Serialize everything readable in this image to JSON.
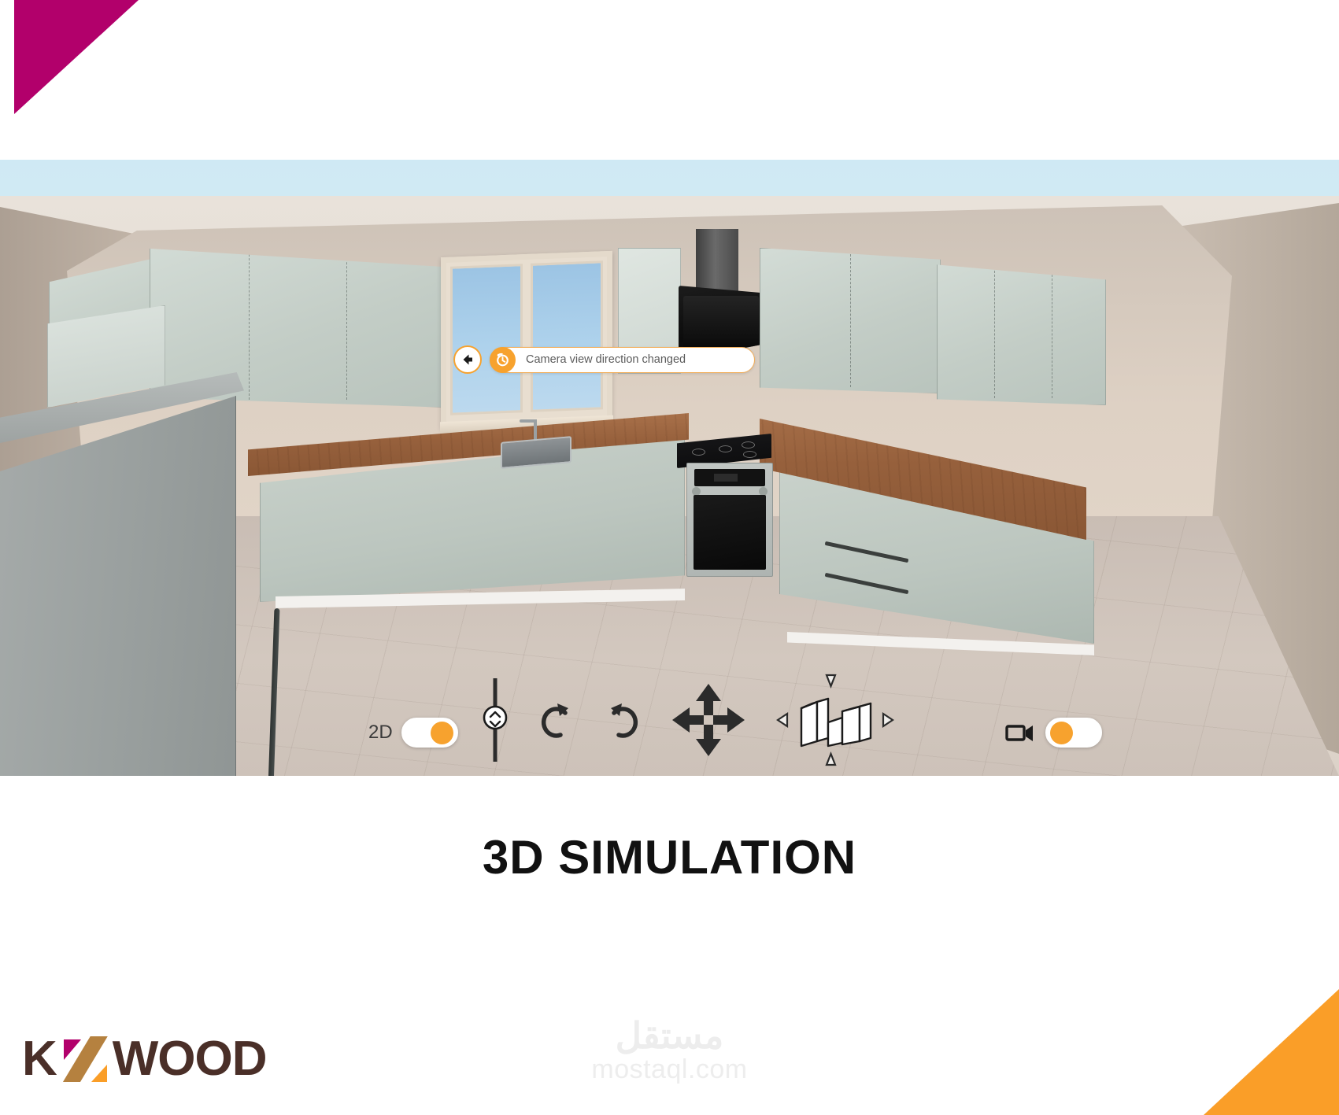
{
  "page": {
    "title": "3D SIMULATION",
    "accent_orange": "#f7a22e",
    "accent_magenta": "#b2006b",
    "brand_brown": "#4a2f28",
    "brand_tan": "#b5813f"
  },
  "notification": {
    "back_button_label": "Back",
    "back_icon": "arrow-left-icon",
    "history_icon": "undo-clock-icon",
    "message": "Camera view direction changed"
  },
  "viewport": {
    "name": "3d-kitchen-viewport",
    "scene": "Corner kitchen with sage-green cabinets, wood countertop, window, range hood, gas cooktop and built-in oven",
    "elements": [
      {
        "name": "upper-cabinet-left-corner",
        "type": "wall-cabinet"
      },
      {
        "name": "upper-cabinet-run-left",
        "type": "wall-cabinet"
      },
      {
        "name": "kitchen-window",
        "type": "window"
      },
      {
        "name": "upper-cabinet-narrow",
        "type": "wall-cabinet"
      },
      {
        "name": "range-hood",
        "type": "appliance"
      },
      {
        "name": "upper-cabinet-right-1",
        "type": "wall-cabinet"
      },
      {
        "name": "upper-cabinet-right-2",
        "type": "wall-cabinet"
      },
      {
        "name": "wood-countertop-left",
        "type": "countertop"
      },
      {
        "name": "wood-countertop-right",
        "type": "countertop"
      },
      {
        "name": "kitchen-sink",
        "type": "fixture"
      },
      {
        "name": "gas-cooktop",
        "type": "appliance"
      },
      {
        "name": "built-in-oven",
        "type": "appliance"
      },
      {
        "name": "base-cabinets-left",
        "type": "base-cabinet"
      },
      {
        "name": "base-cabinets-right",
        "type": "base-cabinet"
      },
      {
        "name": "tall-unit-refrigerator",
        "type": "tall-unit"
      },
      {
        "name": "tiled-floor",
        "type": "floor"
      }
    ]
  },
  "toolbar": {
    "mode_toggle": {
      "label": "2D",
      "state": "on",
      "knob_side": "right"
    },
    "camera_toggle": {
      "icon": "video-camera-icon",
      "state": "on",
      "knob_side": "left"
    },
    "tools": [
      {
        "name": "height-slider",
        "icon": "vertical-slider-icon",
        "label": "Height"
      },
      {
        "name": "rotate-left-tool",
        "icon": "rotate-ccw-icon",
        "label": "Rotate"
      },
      {
        "name": "rotate-right-tool",
        "icon": "rotate-cw-icon",
        "label": "Rotate"
      },
      {
        "name": "pan-tool",
        "icon": "four-way-arrows-icon",
        "label": "Pan"
      },
      {
        "name": "perspective-tool",
        "icon": "3d-boxes-icon",
        "label": "Perspective"
      }
    ]
  },
  "footer": {
    "brand_k": "K",
    "brand_wood": "WOOD",
    "watermark_ar": "مستقل",
    "watermark_en": "mostaql.com"
  }
}
